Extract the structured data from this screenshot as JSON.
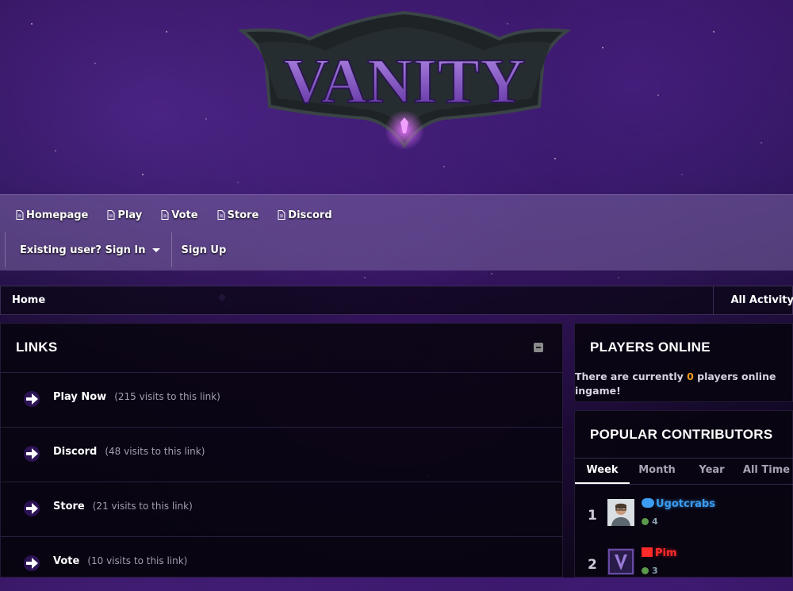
{
  "site": {
    "logo_text": "VANITY"
  },
  "nav": {
    "items": [
      {
        "label": "Homepage"
      },
      {
        "label": "Play"
      },
      {
        "label": "Vote"
      },
      {
        "label": "Store"
      },
      {
        "label": "Discord"
      }
    ],
    "signin_label": "Existing user? Sign In",
    "signup_label": "Sign Up"
  },
  "breadcrumb": {
    "home": "Home",
    "right_label": "All Activity"
  },
  "links_widget": {
    "title": "LINKS",
    "items": [
      {
        "name": "Play Now",
        "count": "(215 visits to this link)"
      },
      {
        "name": "Discord",
        "count": "(48 visits to this link)"
      },
      {
        "name": "Store",
        "count": "(21 visits to this link)"
      },
      {
        "name": "Vote",
        "count": "(10 visits to this link)"
      }
    ]
  },
  "players_online": {
    "title": "PLAYERS ONLINE",
    "text_before": "There are currently ",
    "count": "0",
    "text_after": " players online ingame!"
  },
  "contributors": {
    "title": "POPULAR CONTRIBUTORS",
    "tabs": [
      "Week",
      "Month",
      "Year",
      "All Time"
    ],
    "active_tab": "Week",
    "entries": [
      {
        "rank": "1",
        "name": "Ugotcrabs",
        "rep": "4",
        "color": "#3b9cf0"
      },
      {
        "rank": "2",
        "name": "Pim",
        "rep": "3",
        "color": "#ff2a2a"
      }
    ]
  },
  "colors": {
    "accent_purple": "#8b3fd9",
    "nav_bg": "#786aa0",
    "count_orange": "#f39a1d"
  }
}
